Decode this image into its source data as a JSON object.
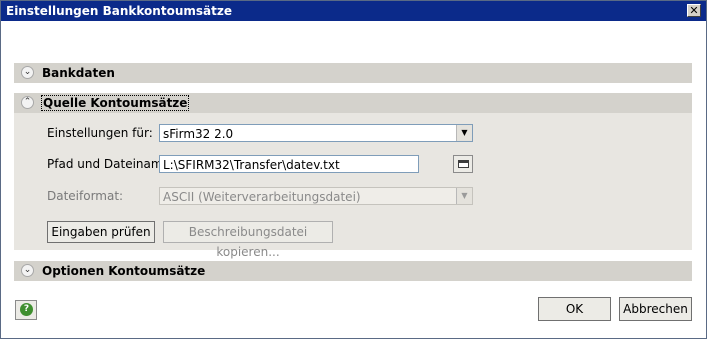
{
  "window": {
    "title": "Einstellungen Bankkontoumsätze",
    "close_symbol": "✕"
  },
  "sections": {
    "bankdaten": {
      "label": "Bankdaten",
      "chevron": "⌄"
    },
    "quelle": {
      "label": "Quelle Kontoumsätze",
      "chevron": "⌃"
    },
    "optionen": {
      "label": "Optionen Kontoumsätze",
      "chevron": "⌄"
    }
  },
  "form": {
    "einstellungen_label": "Einstellungen für:",
    "einstellungen_value": "sFirm32 2.0",
    "pfad_label": "Pfad und Dateiname:",
    "pfad_value": "L:\\SFIRM32\\Transfer\\datev.txt",
    "format_label": "Dateiformat:",
    "format_value": "ASCII (Weiterverarbeitungsdatei)",
    "dropdown_arrow": "▼"
  },
  "buttons": {
    "pruefen": "Eingaben prüfen",
    "kopieren": "Beschreibungsdatei kopieren...",
    "ok": "OK",
    "abbrechen": "Abbrechen"
  },
  "colors": {
    "titlebar": "#0b2a8a",
    "panel": "#e8e6e1",
    "header": "#d4d2cc"
  },
  "icons": {
    "help": "help-icon",
    "browse": "folder-icon"
  }
}
